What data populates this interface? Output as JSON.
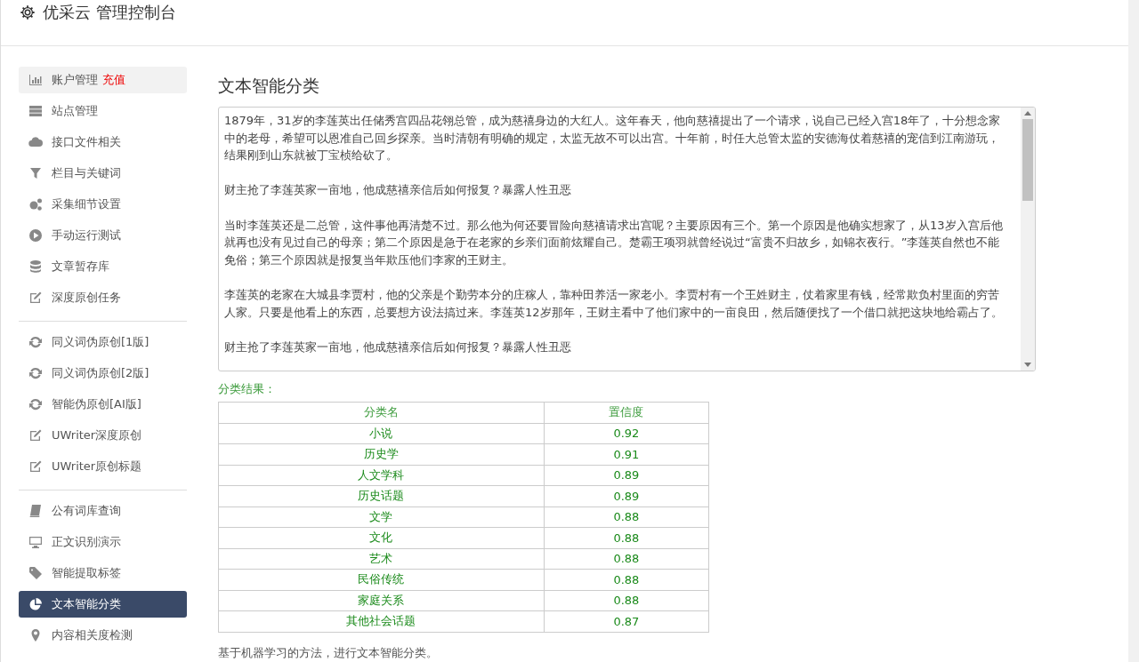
{
  "header": {
    "title": "优采云 管理控制台"
  },
  "sidebar": {
    "groups": [
      {
        "items": [
          {
            "label": "账户管理",
            "badge": "充值",
            "selected": false,
            "hovered": true
          },
          {
            "label": "站点管理",
            "selected": false,
            "hovered": false
          },
          {
            "label": "接口文件相关",
            "selected": false,
            "hovered": false
          },
          {
            "label": "栏目与关键词",
            "selected": false,
            "hovered": false
          },
          {
            "label": "采集细节设置",
            "selected": false,
            "hovered": false
          },
          {
            "label": "手动运行测试",
            "selected": false,
            "hovered": false
          },
          {
            "label": "文章暂存库",
            "selected": false,
            "hovered": false
          },
          {
            "label": "深度原创任务",
            "selected": false,
            "hovered": false
          }
        ]
      },
      {
        "items": [
          {
            "label": "同义词伪原创[1版]",
            "selected": false,
            "hovered": false
          },
          {
            "label": "同义词伪原创[2版]",
            "selected": false,
            "hovered": false
          },
          {
            "label": "智能伪原创[AI版]",
            "selected": false,
            "hovered": false
          },
          {
            "label": "UWriter深度原创",
            "selected": false,
            "hovered": false
          },
          {
            "label": "UWriter原创标题",
            "selected": false,
            "hovered": false
          }
        ]
      },
      {
        "items": [
          {
            "label": "公有词库查询",
            "selected": false,
            "hovered": false
          },
          {
            "label": "正文识别演示",
            "selected": false,
            "hovered": false
          },
          {
            "label": "智能提取标签",
            "selected": false,
            "hovered": false
          },
          {
            "label": "文本智能分类",
            "selected": true,
            "hovered": false
          },
          {
            "label": "内容相关度检测",
            "selected": false,
            "hovered": false
          }
        ]
      }
    ]
  },
  "main": {
    "title": "文本智能分类",
    "text_input": {
      "paragraphs": [
        "1879年，31岁的李莲英出任储秀宫四品花翎总管，成为慈禧身边的大红人。这年春天，他向慈禧提出了一个请求，说自己已经入宫18年了，十分想念家中的老母，希望可以恩准自己回乡探亲。当时清朝有明确的规定，太监无故不可以出宫。十年前，时任大总管太监的安德海仗着慈禧的宠信到江南游玩，结果刚到山东就被丁宝桢给砍了。",
        "财主抢了李莲英家一亩地，他成慈禧亲信后如何报复？暴露人性丑恶",
        "当时李莲英还是二总管，这件事他再清楚不过。那么他为何还要冒险向慈禧请求出宫呢？主要原因有三个。第一个原因是他确实想家了，从13岁入宫后他就再也没有见过自己的母亲；第二个原因是急于在老家的乡亲们面前炫耀自己。楚霸王项羽就曾经说过“富贵不归故乡，如锦衣夜行。”李莲英自然也不能免俗；第三个原因就是报复当年欺压他们李家的王财主。",
        "李莲英的老家在大城县李贾村，他的父亲是个勤劳本分的庄稼人，靠种田养活一家老小。李贾村有一个王姓财主，仗着家里有钱，经常欺负村里面的穷苦人家。只要是他看上的东西，总要想方设法搞过来。李莲英12岁那年，王财主看中了他们家中的一亩良田，然后随便找了一个借口就把这块地给霸占了。",
        "财主抢了李莲英家一亩地，他成慈禧亲信后如何报复？暴露人性丑恶"
      ]
    },
    "results_label": "分类结果：",
    "table": {
      "columns": [
        "分类名",
        "置信度"
      ],
      "rows": [
        [
          "小说",
          "0.92"
        ],
        [
          "历史学",
          "0.91"
        ],
        [
          "人文学科",
          "0.89"
        ],
        [
          "历史话题",
          "0.89"
        ],
        [
          "文学",
          "0.88"
        ],
        [
          "文化",
          "0.88"
        ],
        [
          "艺术",
          "0.88"
        ],
        [
          "民俗传统",
          "0.88"
        ],
        [
          "家庭关系",
          "0.88"
        ],
        [
          "其他社会话题",
          "0.87"
        ]
      ]
    },
    "footer_note": "基于机器学习的方法，进行文本智能分类。"
  }
}
